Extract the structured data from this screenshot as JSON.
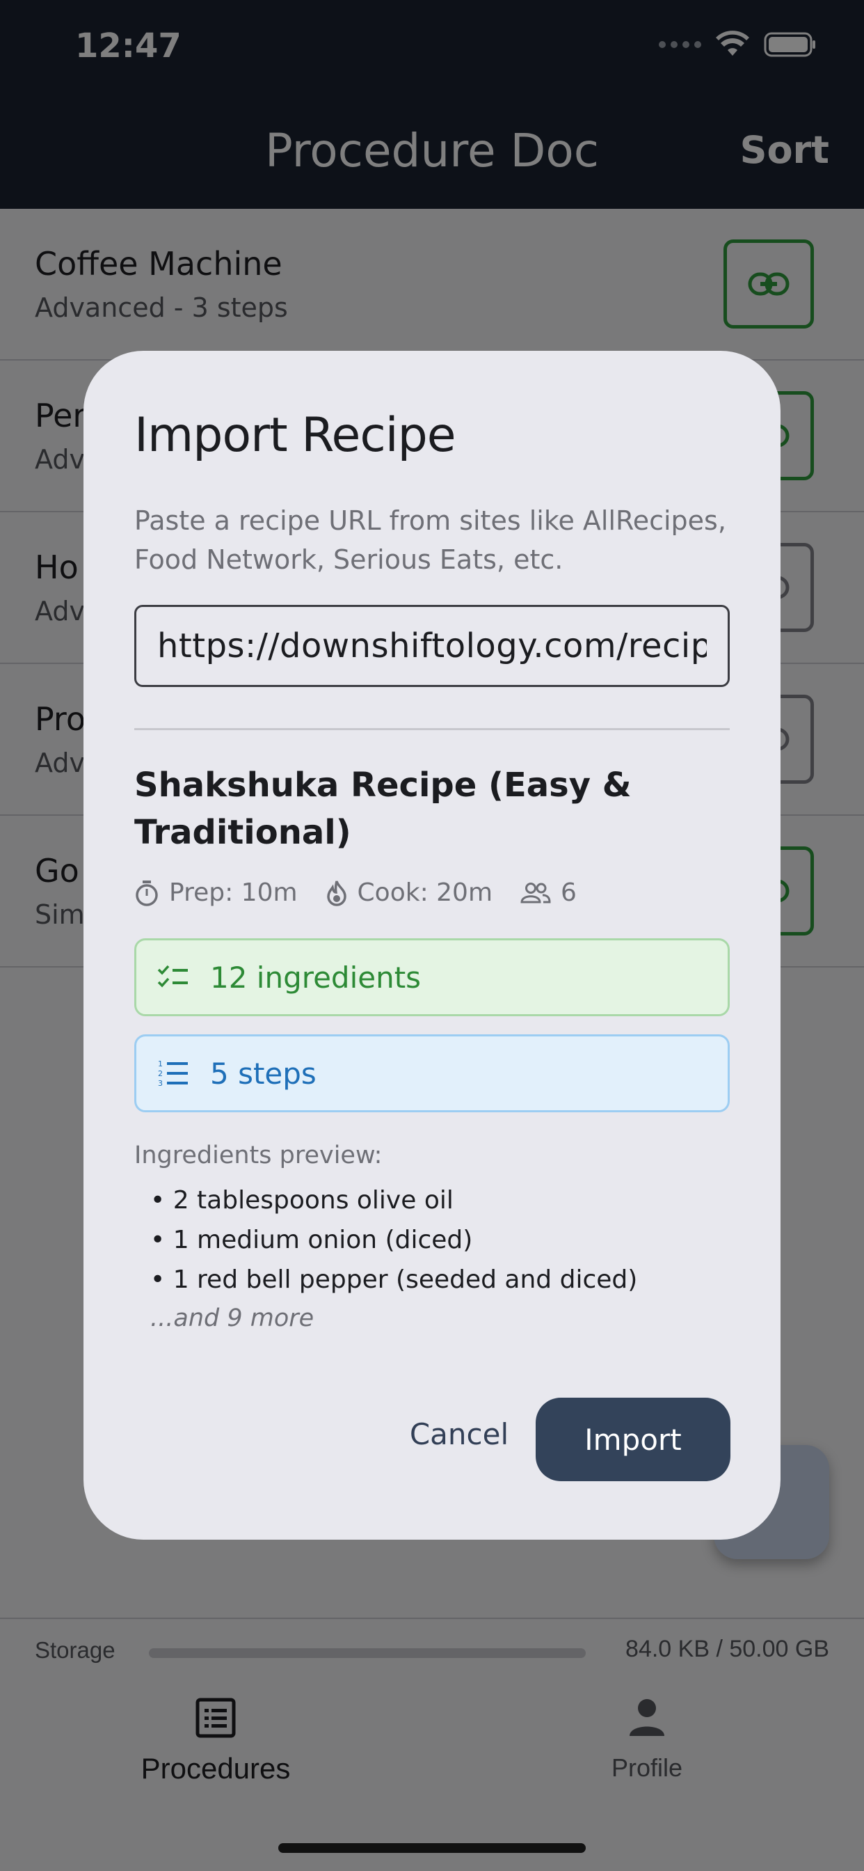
{
  "status_bar": {
    "time": "12:47"
  },
  "app_bar": {
    "title": "Procedure Doc",
    "sort_label": "Sort"
  },
  "procedures": [
    {
      "name": "Coffee Machine",
      "subtitle": "Advanced - 3 steps",
      "link_color": "#2e9a3c"
    },
    {
      "name": "Per",
      "subtitle": "Adv",
      "link_color": "#2e9a3c"
    },
    {
      "name": "Ho",
      "subtitle": "Adv",
      "link_color": "#808088"
    },
    {
      "name": "Pro",
      "subtitle": "Adv",
      "link_color": "#808088"
    },
    {
      "name": "Go",
      "subtitle": "Sim",
      "link_color": "#2e9a3c"
    }
  ],
  "storage": {
    "label": "Storage",
    "value": "84.0 KB / 50.00 GB"
  },
  "bottom_nav": {
    "procedures_label": "Procedures",
    "profile_label": "Profile"
  },
  "dialog": {
    "title": "Import Recipe",
    "description": "Paste a recipe URL from sites like AllRecipes, Food Network, Serious Eats, etc.",
    "url_value": "https://downshiftology.com/recipes/shakshuka/",
    "recipe_title": "Shakshuka Recipe (Easy & Traditional)",
    "prep": "Prep: 10m",
    "cook": "Cook: 20m",
    "servings": "6",
    "ingredients_count": "12 ingredients",
    "steps_count": "5 steps",
    "preview_label": "Ingredients preview:",
    "ingredients_preview": [
      "2 tablespoons olive oil",
      "1 medium onion (diced)",
      "1 red bell pepper (seeded and diced)"
    ],
    "more_text": "...and 9 more",
    "cancel_label": "Cancel",
    "import_label": "Import"
  },
  "colors": {
    "app_bar": "#1b2231",
    "primary_button": "#33435a",
    "ingredients_green": "#2d8a36",
    "steps_blue": "#1e6fb8"
  }
}
